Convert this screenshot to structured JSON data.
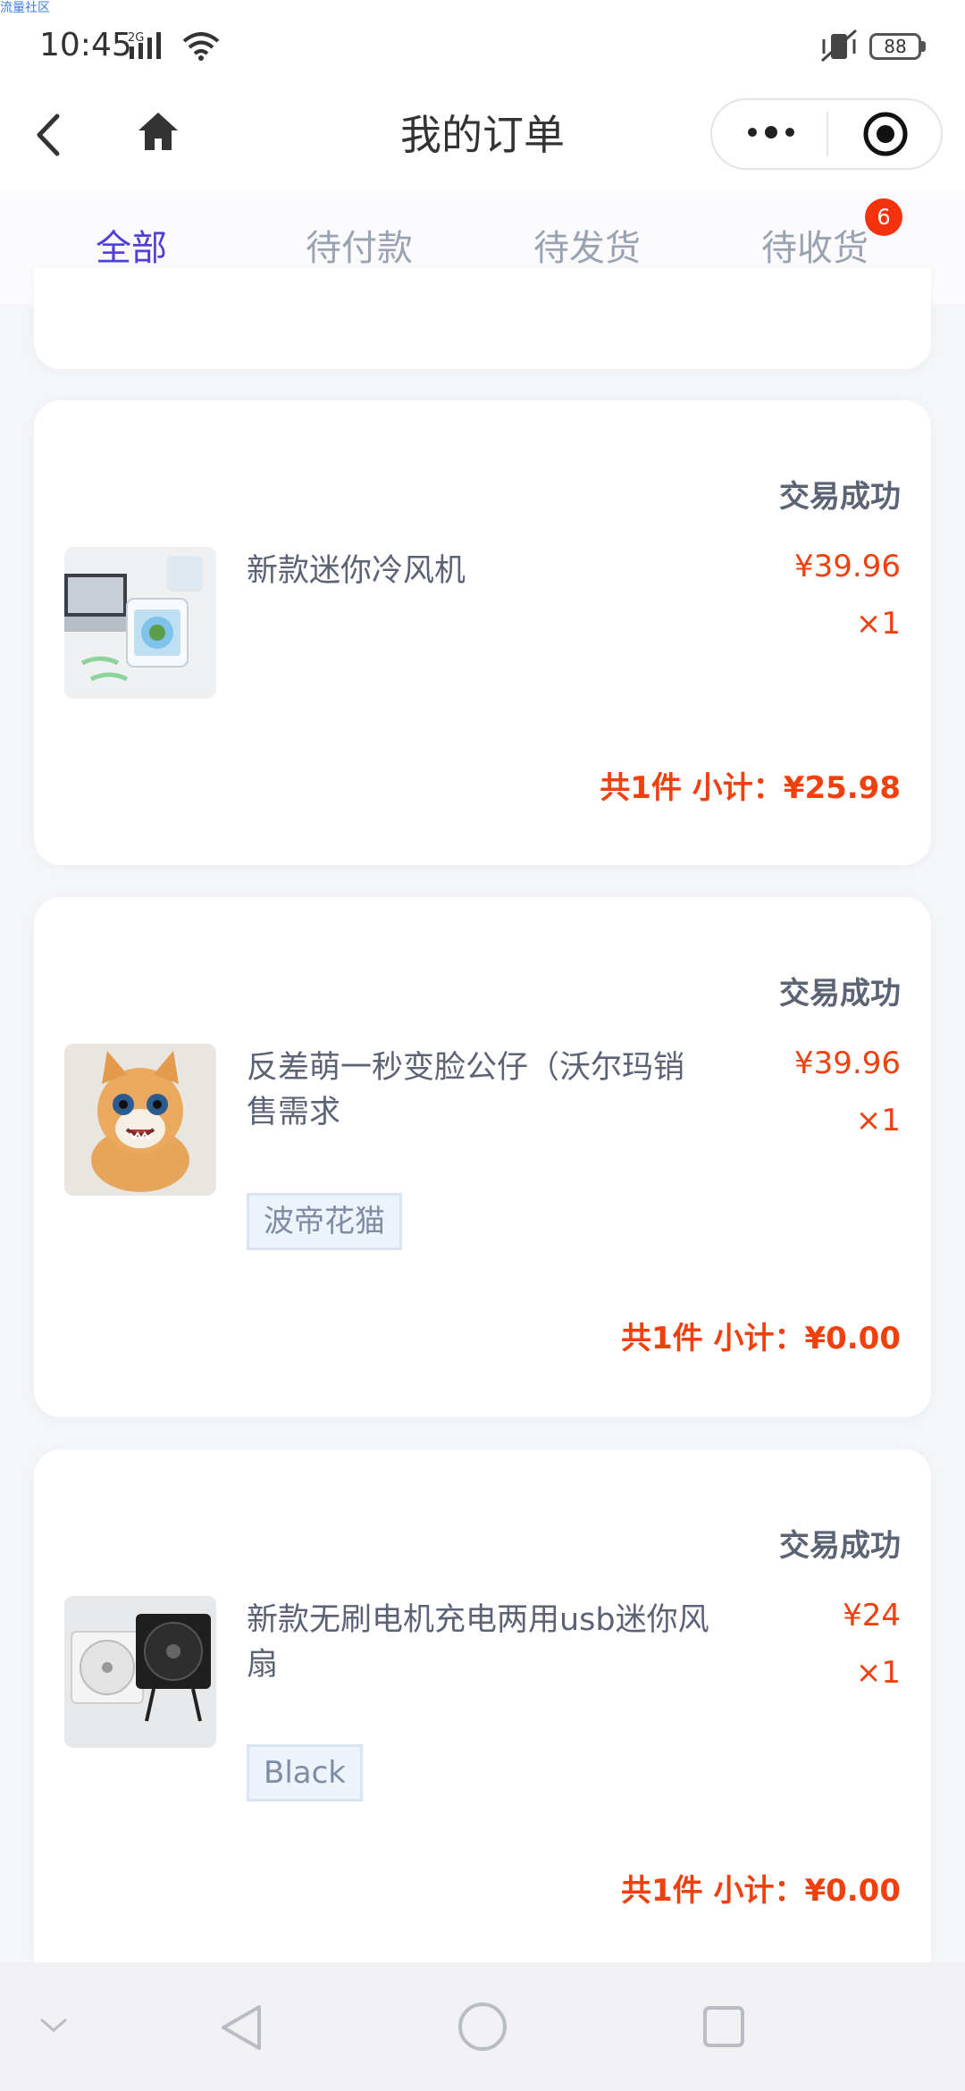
{
  "watermark": "流量社区",
  "status_bar": {
    "time": "10:45",
    "network": "2G",
    "battery": "88"
  },
  "header": {
    "title": "我的订单"
  },
  "tabs": [
    {
      "label": "全部",
      "active": true
    },
    {
      "label": "待付款",
      "active": false
    },
    {
      "label": "待发货",
      "active": false
    },
    {
      "label": "待收货",
      "active": false,
      "badge": "6"
    }
  ],
  "orders": [
    {
      "status": "交易成功",
      "name": "新款迷你冷风机",
      "price": "¥39.96",
      "qty": "×1",
      "spec": "",
      "summary": "共1件 小计：¥25.98"
    },
    {
      "status": "交易成功",
      "name": "反差萌一秒变脸公仔（沃尔玛销售需求",
      "price": "¥39.96",
      "qty": "×1",
      "spec": "波帝花猫",
      "summary": "共1件 小计：¥0.00"
    },
    {
      "status": "交易成功",
      "name": "新款无刷电机充电两用usb迷你风扇",
      "price": "¥24",
      "qty": "×1",
      "spec": "Black",
      "summary": "共1件 小计：¥0.00"
    }
  ],
  "icons": {
    "back": "chevron-left-icon",
    "home": "home-icon",
    "more": "more-dots-icon",
    "close_target": "target-icon",
    "nav_down": "chevron-down-icon",
    "nav_back": "triangle-back-icon",
    "nav_home": "circle-home-icon",
    "nav_recent": "square-recent-icon"
  },
  "colors": {
    "accent": "#4f3fd8",
    "price": "#f0400e",
    "badge": "#f4330e"
  }
}
